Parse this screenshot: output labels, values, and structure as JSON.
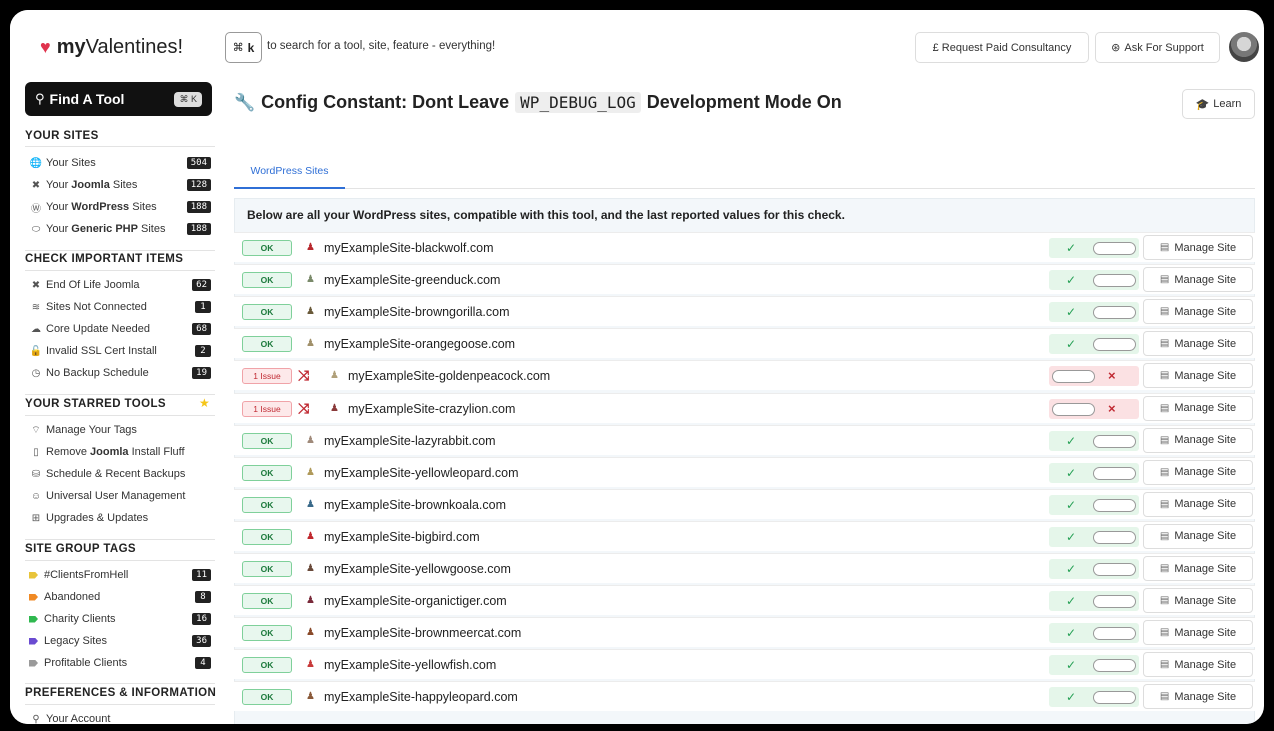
{
  "brand": {
    "prefix": "my",
    "name": "Valentines!"
  },
  "sidebar": {
    "find_label": "Find A Tool",
    "find_kbd": "⌘ K",
    "your_sites_title": "YOUR SITES",
    "your_sites": [
      {
        "icon": "globe-icon",
        "glyph": "🌐",
        "pre": "Your Sites",
        "bold": "",
        "post": "",
        "count": "504"
      },
      {
        "icon": "joomla-icon",
        "glyph": "✖",
        "pre": "Your ",
        "bold": "Joomla",
        "post": " Sites",
        "count": "128"
      },
      {
        "icon": "wordpress-icon",
        "glyph": "Ⓦ",
        "pre": "Your ",
        "bold": "WordPress",
        "post": " Sites",
        "count": "188"
      },
      {
        "icon": "php-icon",
        "glyph": "⬭",
        "pre": "Your ",
        "bold": "Generic PHP",
        "post": " Sites",
        "count": "188"
      }
    ],
    "check_title": "CHECK IMPORTANT ITEMS",
    "check_items": [
      {
        "icon": "joomla-icon",
        "glyph": "✖",
        "label": "End Of Life Joomla",
        "count": "62"
      },
      {
        "icon": "wifi-off-icon",
        "glyph": "≋",
        "label": "Sites Not Connected",
        "count": "1"
      },
      {
        "icon": "cloud-upload-icon",
        "glyph": "☁",
        "label": "Core Update Needed",
        "count": "68"
      },
      {
        "icon": "lock-icon",
        "glyph": "🔓",
        "label": "Invalid SSL Cert Install",
        "count": "2"
      },
      {
        "icon": "clock-icon",
        "glyph": "◷",
        "label": "No Backup Schedule",
        "count": "19"
      }
    ],
    "starred_title": "YOUR STARRED TOOLS",
    "starred_items": [
      {
        "icon": "tag-icon",
        "glyph": "⌔",
        "pre": "Manage Your Tags",
        "bold": "",
        "post": ""
      },
      {
        "icon": "file-icon",
        "glyph": "▯",
        "pre": "Remove ",
        "bold": "Joomla",
        "post": " Install Fluff"
      },
      {
        "icon": "database-icon",
        "glyph": "⛁",
        "pre": "Schedule & Recent Backups",
        "bold": "",
        "post": ""
      },
      {
        "icon": "users-icon",
        "glyph": "☺",
        "pre": "Universal User Management",
        "bold": "",
        "post": ""
      },
      {
        "icon": "boxes-icon",
        "glyph": "⊞",
        "pre": "Upgrades & Updates",
        "bold": "",
        "post": ""
      }
    ],
    "tags_title": "SITE GROUP TAGS",
    "tags": [
      {
        "label": "#ClientsFromHell",
        "color": "#e8c43a",
        "count": "11"
      },
      {
        "label": "Abandoned",
        "color": "#f08a24",
        "count": "8"
      },
      {
        "label": "Charity Clients",
        "color": "#2fb84f",
        "count": "16"
      },
      {
        "label": "Legacy Sites",
        "color": "#6a4bd1",
        "count": "36"
      },
      {
        "label": "Profitable Clients",
        "color": "#9a9a9a",
        "count": "4"
      }
    ],
    "prefs_title": "PREFERENCES & INFORMATION",
    "prefs_items": [
      {
        "icon": "user-icon",
        "glyph": "⚲",
        "label": "Your Account"
      }
    ]
  },
  "topbar": {
    "kbd_cmd": "⌘",
    "kbd_key": "k",
    "search_hint": "to search for a tool, site, feature - everything!",
    "consultancy_label": "£ Request Paid Consultancy",
    "support_label": "Ask For Support"
  },
  "main": {
    "title_pre": "Config Constant: Dont Leave",
    "title_code": "WP_DEBUG_LOG",
    "title_post": "Development Mode On",
    "learn_label": "Learn",
    "tab_label": "WordPress Sites",
    "intro": "Below are all your WordPress sites, compatible with this tool, and the last reported values for this check.",
    "manage_label": "Manage Site",
    "sites": [
      {
        "status": "OK",
        "ok": true,
        "name": "myExampleSite-blackwolf.com",
        "ic": "#b8282e"
      },
      {
        "status": "OK",
        "ok": true,
        "name": "myExampleSite-greenduck.com",
        "ic": "#7a8a6a"
      },
      {
        "status": "OK",
        "ok": true,
        "name": "myExampleSite-browngorilla.com",
        "ic": "#6a5a3a"
      },
      {
        "status": "OK",
        "ok": true,
        "name": "myExampleSite-orangegoose.com",
        "ic": "#a0906a"
      },
      {
        "status": "1 Issue",
        "ok": false,
        "name": "myExampleSite-goldenpeacock.com",
        "ic": "#b0a07a"
      },
      {
        "status": "1 Issue",
        "ok": false,
        "name": "myExampleSite-crazylion.com",
        "ic": "#8a3a3a"
      },
      {
        "status": "OK",
        "ok": true,
        "name": "myExampleSite-lazyrabbit.com",
        "ic": "#a08a7a"
      },
      {
        "status": "OK",
        "ok": true,
        "name": "myExampleSite-yellowleopard.com",
        "ic": "#b09a5a"
      },
      {
        "status": "OK",
        "ok": true,
        "name": "myExampleSite-brownkoala.com",
        "ic": "#3a6a8a"
      },
      {
        "status": "OK",
        "ok": true,
        "name": "myExampleSite-bigbird.com",
        "ic": "#c0282e"
      },
      {
        "status": "OK",
        "ok": true,
        "name": "myExampleSite-yellowgoose.com",
        "ic": "#6a4a3a"
      },
      {
        "status": "OK",
        "ok": true,
        "name": "myExampleSite-organictiger.com",
        "ic": "#7a2a3a"
      },
      {
        "status": "OK",
        "ok": true,
        "name": "myExampleSite-brownmeercat.com",
        "ic": "#8a4a2a"
      },
      {
        "status": "OK",
        "ok": true,
        "name": "myExampleSite-yellowfish.com",
        "ic": "#c83a3a"
      },
      {
        "status": "OK",
        "ok": true,
        "name": "myExampleSite-happyleopard.com",
        "ic": "#8a5a3a"
      }
    ]
  },
  "colors": {
    "accent": "#2f6fd6",
    "ok_green": "#26a055",
    "issue_red": "#c02a33",
    "heart": "#e0334d"
  }
}
